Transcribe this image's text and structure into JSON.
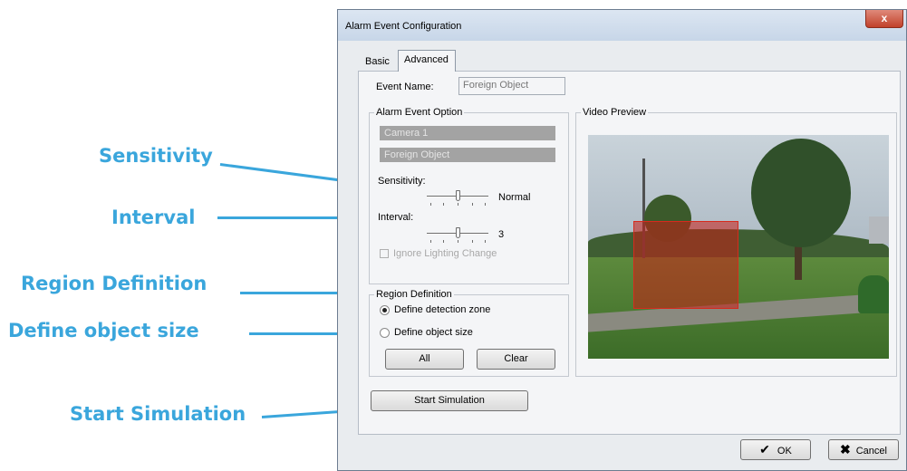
{
  "callouts": {
    "sensitivity": "Sensitivity",
    "interval": "Interval",
    "region_definition": "Region Definition",
    "define_object_size": "Define object size",
    "start_simulation": "Start Simulation"
  },
  "window": {
    "title": "Alarm Event Configuration",
    "close_glyph": "x"
  },
  "tabs": [
    {
      "label": "Basic",
      "selected": false
    },
    {
      "label": "Advanced",
      "selected": true
    }
  ],
  "event_name": {
    "label": "Event Name:",
    "value": "Foreign Object"
  },
  "alarm_event_option": {
    "legend": "Alarm Event Option",
    "camera": "Camera 1",
    "event_type": "Foreign Object",
    "sensitivity_label": "Sensitivity:",
    "sensitivity_value": "Normal",
    "interval_label": "Interval:",
    "interval_value": "3",
    "ignore_lighting_label": "Ignore Lighting Change",
    "ignore_lighting_checked": false
  },
  "region_definition": {
    "legend": "Region Definition",
    "options": [
      {
        "label": "Define detection zone",
        "selected": true
      },
      {
        "label": "Define object size",
        "selected": false
      }
    ],
    "all_button": "All",
    "clear_button": "Clear"
  },
  "video_preview": {
    "legend": "Video Preview",
    "zone_color": "#d62a1d"
  },
  "start_simulation_button": "Start Simulation",
  "footer": {
    "ok_button": "OK",
    "cancel_button": "Cancel",
    "ok_icon": "checkmark-icon",
    "cancel_icon": "x-mark-icon"
  },
  "colors": {
    "callout": "#3aa6dc",
    "dialog_bg": "#e9ecef",
    "selection_grey": "#a3a3a3"
  }
}
